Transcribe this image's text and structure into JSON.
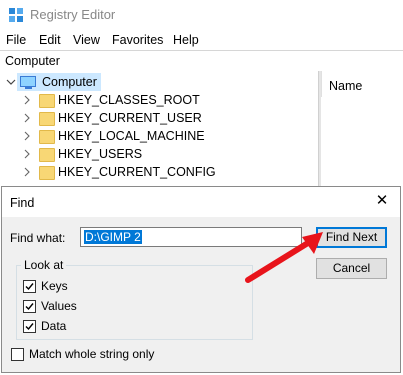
{
  "window": {
    "title": "Registry Editor"
  },
  "menu": [
    "File",
    "Edit",
    "View",
    "Favorites",
    "Help"
  ],
  "address": "Computer",
  "list_header": {
    "name_column": "Name"
  },
  "tree": {
    "root": "Computer",
    "children": [
      "HKEY_CLASSES_ROOT",
      "HKEY_CURRENT_USER",
      "HKEY_LOCAL_MACHINE",
      "HKEY_USERS",
      "HKEY_CURRENT_CONFIG"
    ]
  },
  "find_dialog": {
    "title": "Find",
    "close_glyph": "✕",
    "find_what_label": "Find what:",
    "find_what_value": "D:\\GIMP 2",
    "find_next_label": "Find Next",
    "cancel_label": "Cancel",
    "look_at_label": "Look at",
    "keys_label": "Keys",
    "values_label": "Values",
    "data_label": "Data",
    "keys_checked": true,
    "values_checked": true,
    "data_checked": true,
    "match_whole_label": "Match whole string only",
    "match_whole_checked": false
  },
  "colors": {
    "accent": "#0078d7",
    "annotation_arrow": "#e8141b",
    "selection_bg": "#cce8ff"
  }
}
